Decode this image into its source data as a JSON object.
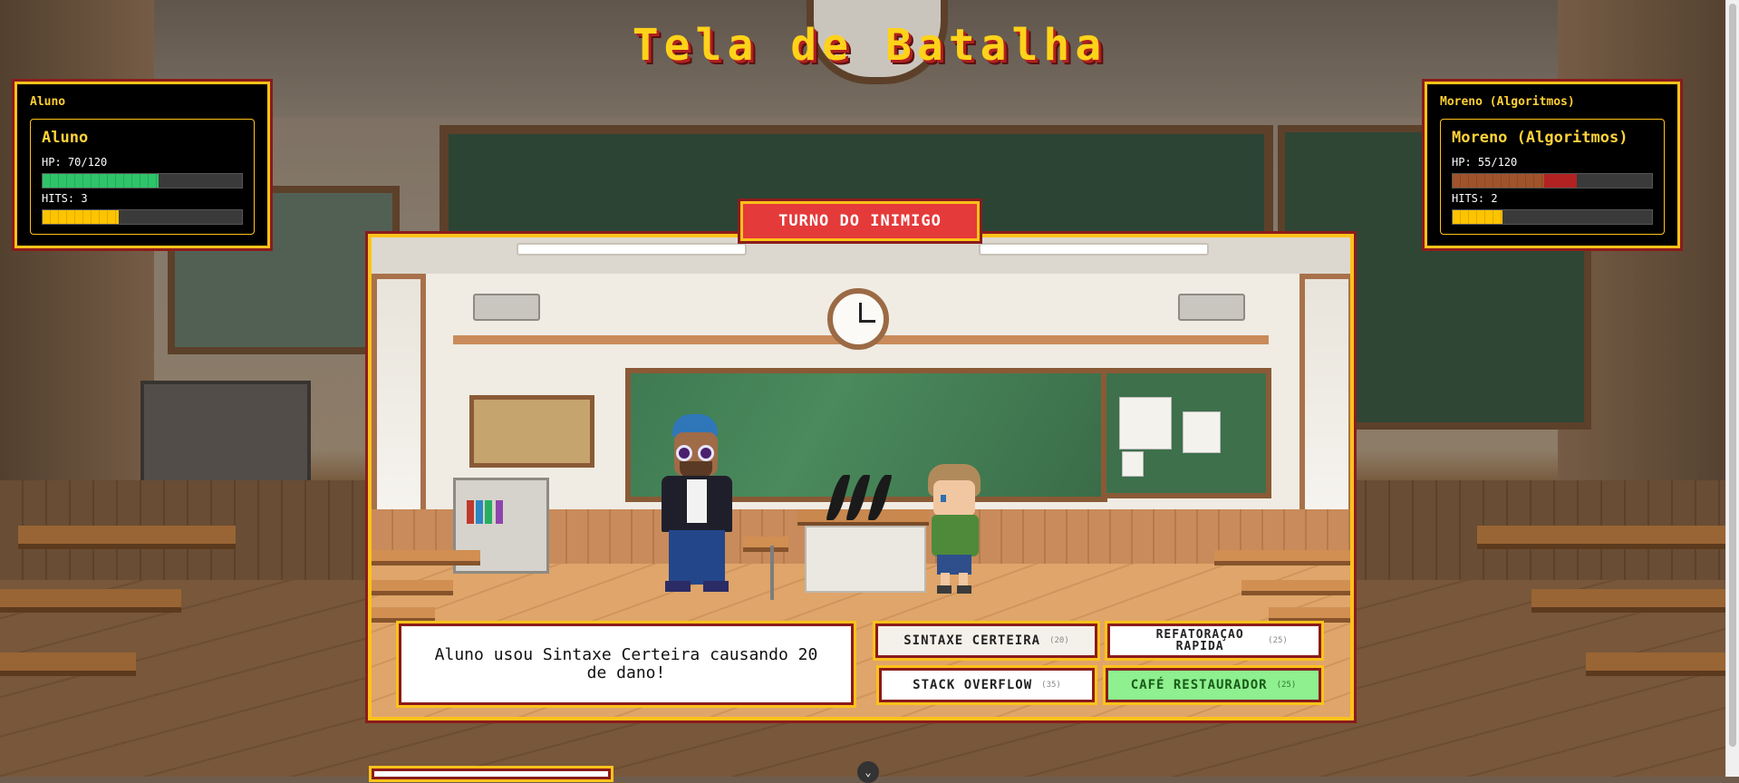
{
  "title": "Tela de Batalha",
  "player": {
    "panel_title": "Aluno",
    "name": "Aluno",
    "hp_label": "HP: 70/120",
    "hp_fraction": 0.583,
    "hits_label": "HITS: 3",
    "hits_fraction": 0.38
  },
  "enemy": {
    "panel_title": "Moreno (Algoritmos)",
    "name": "Moreno (Algoritmos)",
    "hp_label": "HP: 55/120",
    "hp_fraction": 0.458,
    "hp_recent_loss_fraction": 0.167,
    "hits_label": "HITS: 2",
    "hits_fraction": 0.25
  },
  "turn_banner": "TURNO DO INIMIGO",
  "message": "Aluno usou Sintaxe Certeira causando 20 de dano!",
  "actions": {
    "sintaxe": {
      "label": "SINTAXE CERTEIRA",
      "cost": "(20)"
    },
    "refatoracao": {
      "label": "REFATORAÇAO RAPIDA",
      "cost": "(25)"
    },
    "stack": {
      "label": "STACK OVERFLOW",
      "cost": "(35)"
    },
    "cafe": {
      "label": "CAFÉ RESTAURADOR",
      "cost": "(25)"
    }
  },
  "colors": {
    "accent_gold": "#ffc21a",
    "frame_red": "#8a1c1c",
    "banner_red": "#e53a3a",
    "hp_green": "#2fc46a",
    "enemy_hp_brown": "#a0532a",
    "hits_yellow": "#ffc400",
    "heal_green": "#8ef08e"
  },
  "icons": {
    "scroll_down": "chevron-down-icon"
  }
}
